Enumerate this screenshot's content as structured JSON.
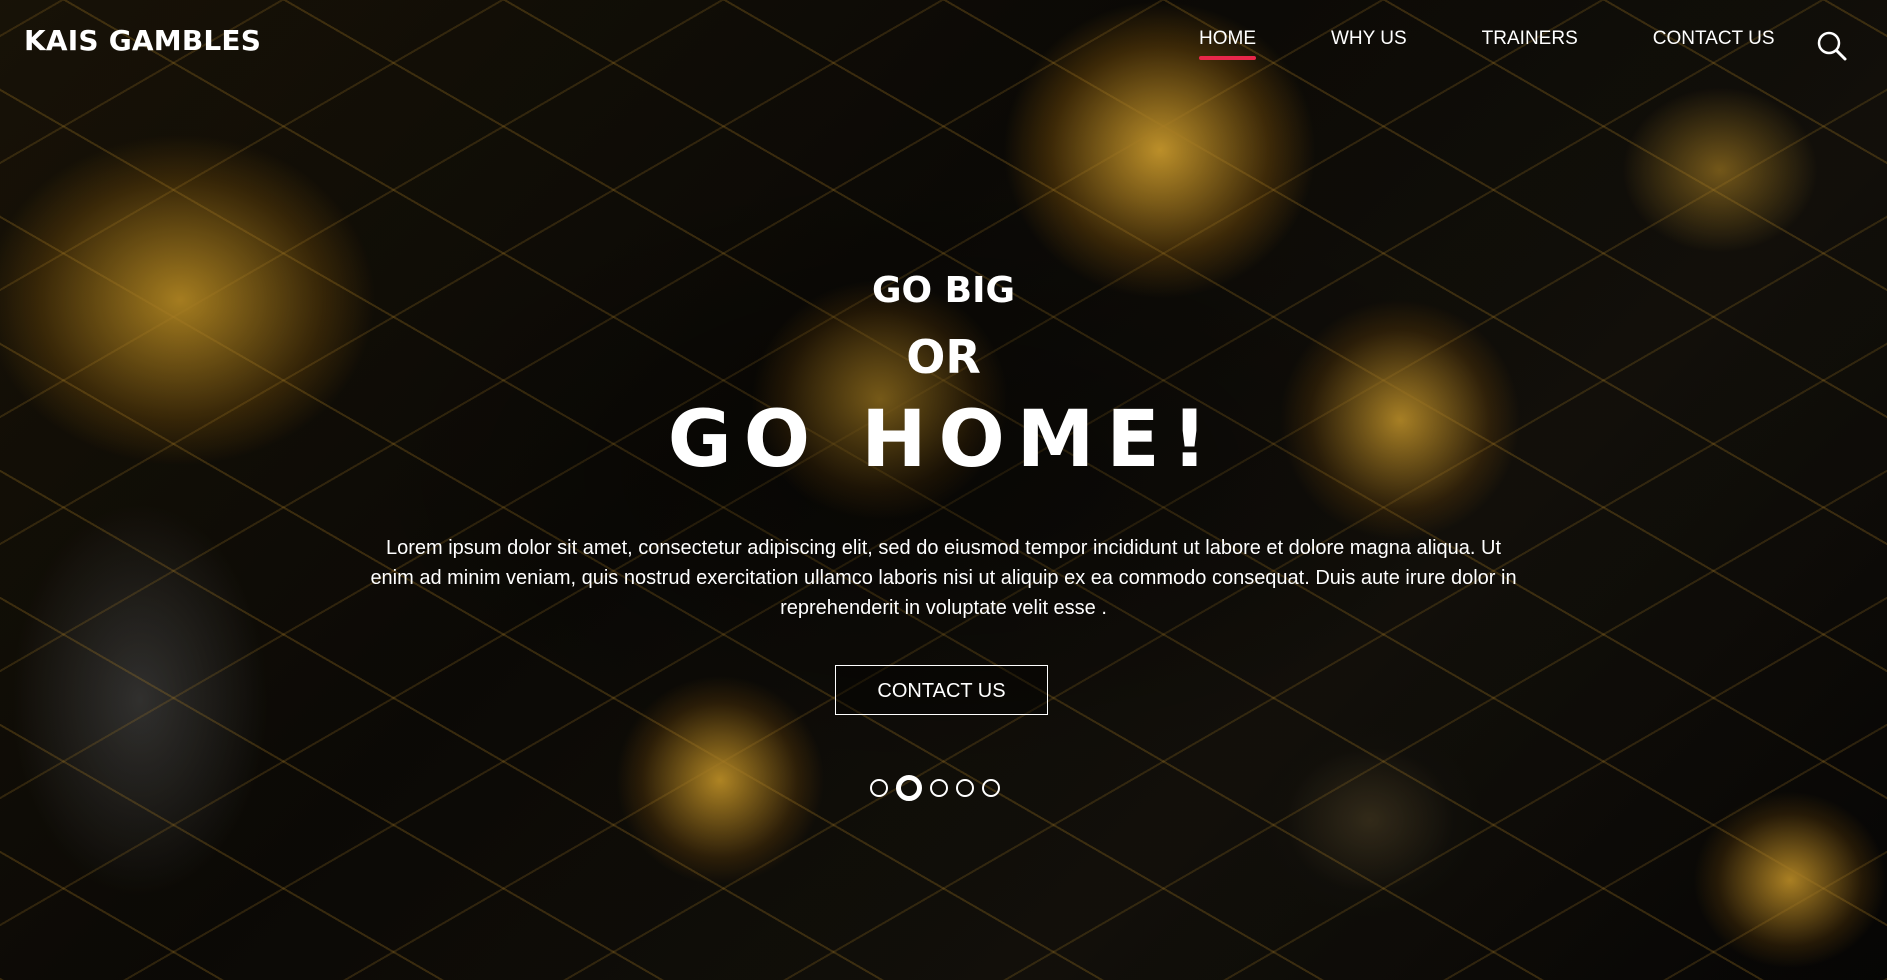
{
  "header": {
    "brand": "KAIS GAMBLES",
    "nav": [
      {
        "label": "HOME",
        "active": true
      },
      {
        "label": "WHY US",
        "active": false
      },
      {
        "label": "TRAINERS",
        "active": false
      },
      {
        "label": "CONTACT US",
        "active": false
      }
    ],
    "search_icon": "search-icon",
    "active_underline_color": "#e8274a"
  },
  "hero": {
    "line1": "GO BIG",
    "line2": "OR",
    "line3": "GO HOME!",
    "paragraph": "Lorem ipsum dolor sit amet, consectetur adipiscing elit, sed do eiusmod tempor incididunt ut labore et dolore magna aliqua. Ut enim ad minim veniam, quis nostrud exercitation ullamco laboris nisi ut aliquip ex ea commodo consequat. Duis aute irure dolor in reprehenderit in voluptate velit esse .",
    "cta_label": "CONTACT US"
  },
  "carousel": {
    "slide_count": 5,
    "active_index": 1
  }
}
